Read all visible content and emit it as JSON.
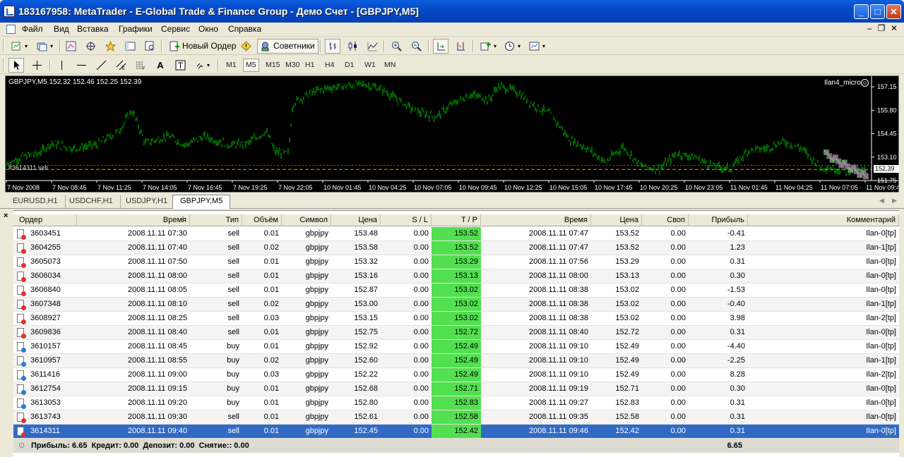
{
  "window": {
    "title": "183167958: MetaTrader - E-Global Trade & Finance Group - Демо Счет - [GBPJPY,M5]"
  },
  "menu": [
    "Файл",
    "Вид",
    "Вставка",
    "Графики",
    "Сервис",
    "Окно",
    "Справка"
  ],
  "toolbar": {
    "new_order": "Новый Ордер",
    "experts": "Советники"
  },
  "timeframes": [
    "M1",
    "M5",
    "M15",
    "M30",
    "H1",
    "H4",
    "D1",
    "W1",
    "MN"
  ],
  "active_timeframe": "M5",
  "chart": {
    "info": "GBPJPY,M5  152.32 152.46 152.25 152.39",
    "expert": "Ilan4_micro",
    "order_label": "#3614311 sell",
    "current_price": "152.39"
  },
  "chart_data": {
    "type": "bar",
    "symbol": "GBPJPY",
    "timeframe": "M5",
    "ylim": [
      151.75,
      157.6
    ],
    "y_ticks": [
      "157.15",
      "155.80",
      "154.45",
      "153.10",
      "151.75"
    ],
    "x_ticks": [
      "7 Nov 2008",
      "7 Nov 08:45",
      "7 Nov 11:25",
      "7 Nov 14:05",
      "7 Nov 16:45",
      "7 Nov 19:25",
      "7 Nov 22:05",
      "10 Nov 01:45",
      "10 Nov 04:25",
      "10 Nov 07:05",
      "10 Nov 09:45",
      "10 Nov 12:25",
      "10 Nov 15:05",
      "10 Nov 17:45",
      "10 Nov 20:25",
      "10 Nov 23:05",
      "11 Nov 01:45",
      "11 Nov 04:25",
      "11 Nov 07:05",
      "11 Nov 09:4"
    ],
    "price_path": [
      [
        0,
        152.7
      ],
      [
        0.3,
        153.1
      ],
      [
        0.7,
        153.3
      ],
      [
        1.0,
        153.9
      ],
      [
        1.5,
        153.6
      ],
      [
        2.0,
        153.8
      ],
      [
        2.5,
        154.6
      ],
      [
        2.8,
        155.8
      ],
      [
        3.1,
        153.9
      ],
      [
        3.6,
        154.3
      ],
      [
        4.0,
        153.8
      ],
      [
        4.4,
        154.3
      ],
      [
        5.0,
        153.8
      ],
      [
        5.4,
        153.9
      ],
      [
        5.8,
        154.6
      ],
      [
        6.0,
        153.4
      ],
      [
        6.3,
        153.3
      ],
      [
        6.4,
        156.2
      ],
      [
        6.8,
        156.8
      ],
      [
        7.2,
        157.1
      ],
      [
        7.6,
        157.2
      ],
      [
        8.0,
        157.3
      ],
      [
        8.4,
        157.0
      ],
      [
        8.8,
        156.3
      ],
      [
        9.2,
        155.7
      ],
      [
        9.6,
        155.4
      ],
      [
        10.0,
        156.2
      ],
      [
        10.4,
        156.7
      ],
      [
        10.8,
        156.4
      ],
      [
        11.0,
        157.2
      ],
      [
        11.4,
        156.9
      ],
      [
        11.8,
        156.1
      ],
      [
        12.2,
        155.5
      ],
      [
        12.6,
        154.1
      ],
      [
        13.0,
        153.6
      ],
      [
        13.4,
        152.8
      ],
      [
        13.8,
        153.7
      ],
      [
        14.2,
        152.6
      ],
      [
        14.6,
        152.4
      ],
      [
        15.0,
        153.3
      ],
      [
        15.4,
        153.1
      ],
      [
        15.8,
        152.6
      ],
      [
        16.2,
        152.4
      ],
      [
        16.6,
        153.5
      ],
      [
        17.0,
        153.6
      ],
      [
        17.4,
        154.0
      ],
      [
        17.8,
        153.6
      ],
      [
        18.2,
        152.6
      ],
      [
        18.6,
        152.4
      ],
      [
        18.8,
        152.3
      ],
      [
        19.0,
        152.4
      ],
      [
        19.3,
        152.3
      ]
    ],
    "levels": [
      152.39,
      152.42
    ]
  },
  "chart_tabs": [
    "EURUSD,H1",
    "USDCHF,H1",
    "USDJPY,H1",
    "GBPJPY,M5"
  ],
  "active_chart_tab": "GBPJPY,M5",
  "terminal": {
    "close": "×",
    "columns": [
      "Ордер",
      "Время",
      "Тип",
      "Объём",
      "Символ",
      "Цена",
      "S / L",
      "T / P",
      "Время",
      "Цена",
      "Своп",
      "Прибыль",
      "Комментарий"
    ],
    "sort_mark": "/",
    "rows": [
      [
        "3603451",
        "2008.11.11 07:30",
        "sell",
        "0.01",
        "gbpjpy",
        "153.48",
        "0.00",
        "153.52",
        "2008.11.11 07:47",
        "153.52",
        "0.00",
        "-0.41",
        "Ilan-0[tp]"
      ],
      [
        "3604255",
        "2008.11.11 07:40",
        "sell",
        "0.02",
        "gbpjpy",
        "153.58",
        "0.00",
        "153.52",
        "2008.11.11 07:47",
        "153.52",
        "0.00",
        "1.23",
        "Ilan-1[tp]"
      ],
      [
        "3605073",
        "2008.11.11 07:50",
        "sell",
        "0.01",
        "gbpjpy",
        "153.32",
        "0.00",
        "153.29",
        "2008.11.11 07:56",
        "153.29",
        "0.00",
        "0.31",
        "Ilan-0[tp]"
      ],
      [
        "3606034",
        "2008.11.11 08:00",
        "sell",
        "0.01",
        "gbpjpy",
        "153.16",
        "0.00",
        "153.13",
        "2008.11.11 08:00",
        "153.13",
        "0.00",
        "0.30",
        "Ilan-0[tp]"
      ],
      [
        "3606840",
        "2008.11.11 08:05",
        "sell",
        "0.01",
        "gbpjpy",
        "152.87",
        "0.00",
        "153.02",
        "2008.11.11 08:38",
        "153.02",
        "0.00",
        "-1.53",
        "Ilan-0[tp]"
      ],
      [
        "3607348",
        "2008.11.11 08:10",
        "sell",
        "0.02",
        "gbpjpy",
        "153.00",
        "0.00",
        "153.02",
        "2008.11.11 08:38",
        "153.02",
        "0.00",
        "-0.40",
        "Ilan-1[tp]"
      ],
      [
        "3608927",
        "2008.11.11 08:25",
        "sell",
        "0.03",
        "gbpjpy",
        "153.15",
        "0.00",
        "153.02",
        "2008.11.11 08:38",
        "153.02",
        "0.00",
        "3.98",
        "Ilan-2[tp]"
      ],
      [
        "3609836",
        "2008.11.11 08:40",
        "sell",
        "0.01",
        "gbpjpy",
        "152.75",
        "0.00",
        "152.72",
        "2008.11.11 08:40",
        "152.72",
        "0.00",
        "0.31",
        "Ilan-0[tp]"
      ],
      [
        "3610157",
        "2008.11.11 08:45",
        "buy",
        "0.01",
        "gbpjpy",
        "152.92",
        "0.00",
        "152.49",
        "2008.11.11 09:10",
        "152.49",
        "0.00",
        "-4.40",
        "Ilan-0[tp]"
      ],
      [
        "3610957",
        "2008.11.11 08:55",
        "buy",
        "0.02",
        "gbpjpy",
        "152.60",
        "0.00",
        "152.49",
        "2008.11.11 09:10",
        "152.49",
        "0.00",
        "-2.25",
        "Ilan-1[tp]"
      ],
      [
        "3611416",
        "2008.11.11 09:00",
        "buy",
        "0.03",
        "gbpjpy",
        "152.22",
        "0.00",
        "152.49",
        "2008.11.11 09:10",
        "152.49",
        "0.00",
        "8.28",
        "Ilan-2[tp]"
      ],
      [
        "3612754",
        "2008.11.11 09:15",
        "buy",
        "0.01",
        "gbpjpy",
        "152.68",
        "0.00",
        "152.71",
        "2008.11.11 09:19",
        "152.71",
        "0.00",
        "0.30",
        "Ilan-0[tp]"
      ],
      [
        "3613053",
        "2008.11.11 09:20",
        "buy",
        "0.01",
        "gbpjpy",
        "152.80",
        "0.00",
        "152.83",
        "2008.11.11 09:27",
        "152.83",
        "0.00",
        "0.31",
        "Ilan-0[tp]"
      ],
      [
        "3613743",
        "2008.11.11 09:30",
        "sell",
        "0.01",
        "gbpjpy",
        "152.61",
        "0.00",
        "152.58",
        "2008.11.11 09:35",
        "152.58",
        "0.00",
        "0.31",
        "Ilan-0[tp]"
      ],
      [
        "3614311",
        "2008.11.11 09:40",
        "sell",
        "0.01",
        "gbpjpy",
        "152.45",
        "0.00",
        "152.42",
        "2008.11.11 09:46",
        "152.42",
        "0.00",
        "0.31",
        "Ilan-0[tp]"
      ]
    ],
    "selected_row": 14,
    "summary": "Прибыль: 6.65  Кредит: 0.00  Депозит: 0.00  Снятие:: 0.00",
    "summary_total": "6.65"
  },
  "colors": {
    "chart_bg": "#000000",
    "bars": "#00c000",
    "tp_cell": "#52e050",
    "selected": "#316ac5"
  }
}
